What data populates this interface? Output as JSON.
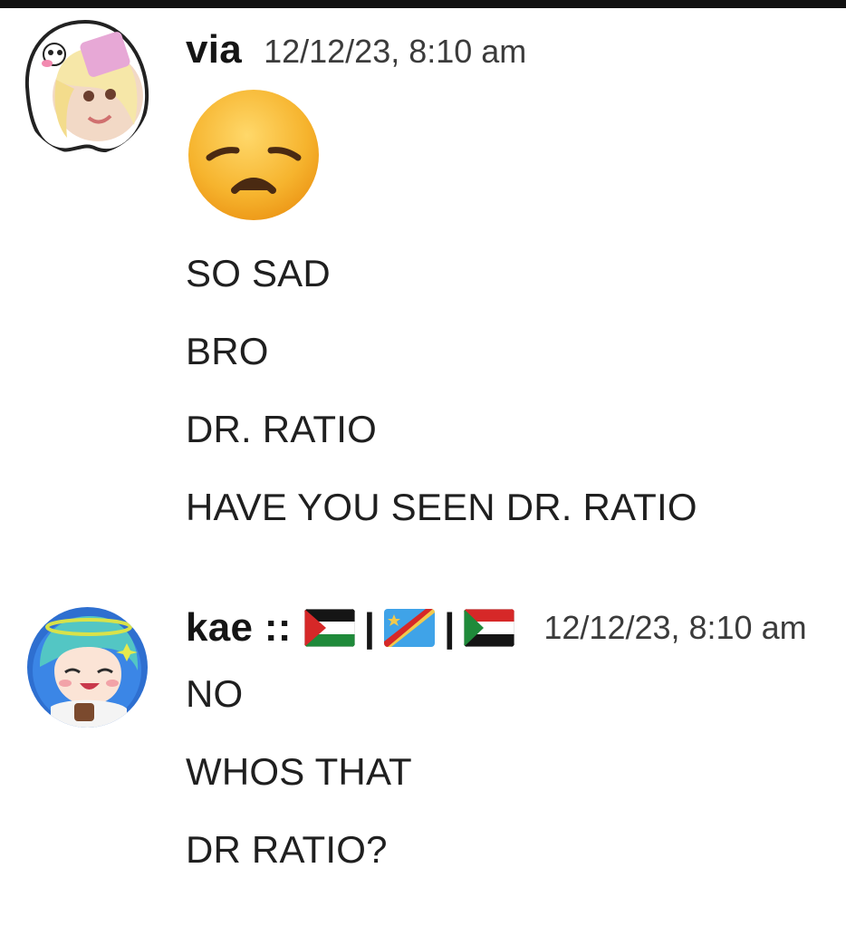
{
  "messages": [
    {
      "author": "via",
      "timestamp": "12/12/23, 8:10 am",
      "big_emoji": "disappointed-face-emoji",
      "lines": [
        "SO SAD",
        "BRO",
        "DR. RATIO",
        "HAVE YOU SEEN DR. RATIO"
      ]
    },
    {
      "author": "kae ::",
      "author_flags": [
        "palestine-flag",
        "dr-congo-flag",
        "sudan-flag"
      ],
      "separator": "|",
      "timestamp": "12/12/23, 8:10 am",
      "lines": [
        "NO",
        "WHOS THAT",
        "DR RATIO?"
      ]
    }
  ]
}
